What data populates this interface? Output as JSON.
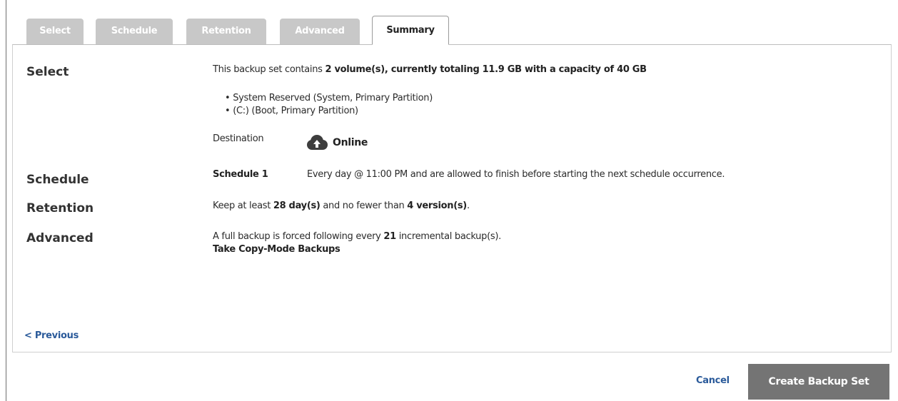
{
  "tabs": [
    {
      "label": "Select"
    },
    {
      "label": "Schedule"
    },
    {
      "label": "Retention"
    },
    {
      "label": "Advanced"
    },
    {
      "label": "Summary"
    }
  ],
  "summary": {
    "select": {
      "label": "Select",
      "intro_prefix": "This backup set contains ",
      "intro_bold": "2 volume(s), currently totaling 11.9 GB with a capacity of 40 GB",
      "volumes": [
        "System Reserved (System, Primary Partition)",
        "(C:) (Boot, Primary Partition)"
      ],
      "destination_label": "Destination",
      "destination_value": "Online",
      "destination_icon": "cloud-icon"
    },
    "schedule": {
      "label": "Schedule",
      "name": "Schedule 1",
      "description": "Every day @ 11:00 PM and are allowed to finish before starting the next schedule occurrence."
    },
    "retention": {
      "label": "Retention",
      "prefix": "Keep at least ",
      "days": "28 day(s)",
      "middle": " and no fewer than ",
      "versions": "4 version(s)",
      "suffix": "."
    },
    "advanced": {
      "label": "Advanced",
      "line1_prefix": "A full backup is forced following every ",
      "line1_count": "21",
      "line1_suffix": " incremental backup(s).",
      "line2": "Take Copy-Mode Backups"
    }
  },
  "nav": {
    "previous": "< Previous",
    "cancel": "Cancel",
    "create": "Create Backup Set"
  },
  "colors": {
    "tab_inactive": "#c8c8c8",
    "link": "#2a5a9a",
    "primary_button": "#747474"
  }
}
